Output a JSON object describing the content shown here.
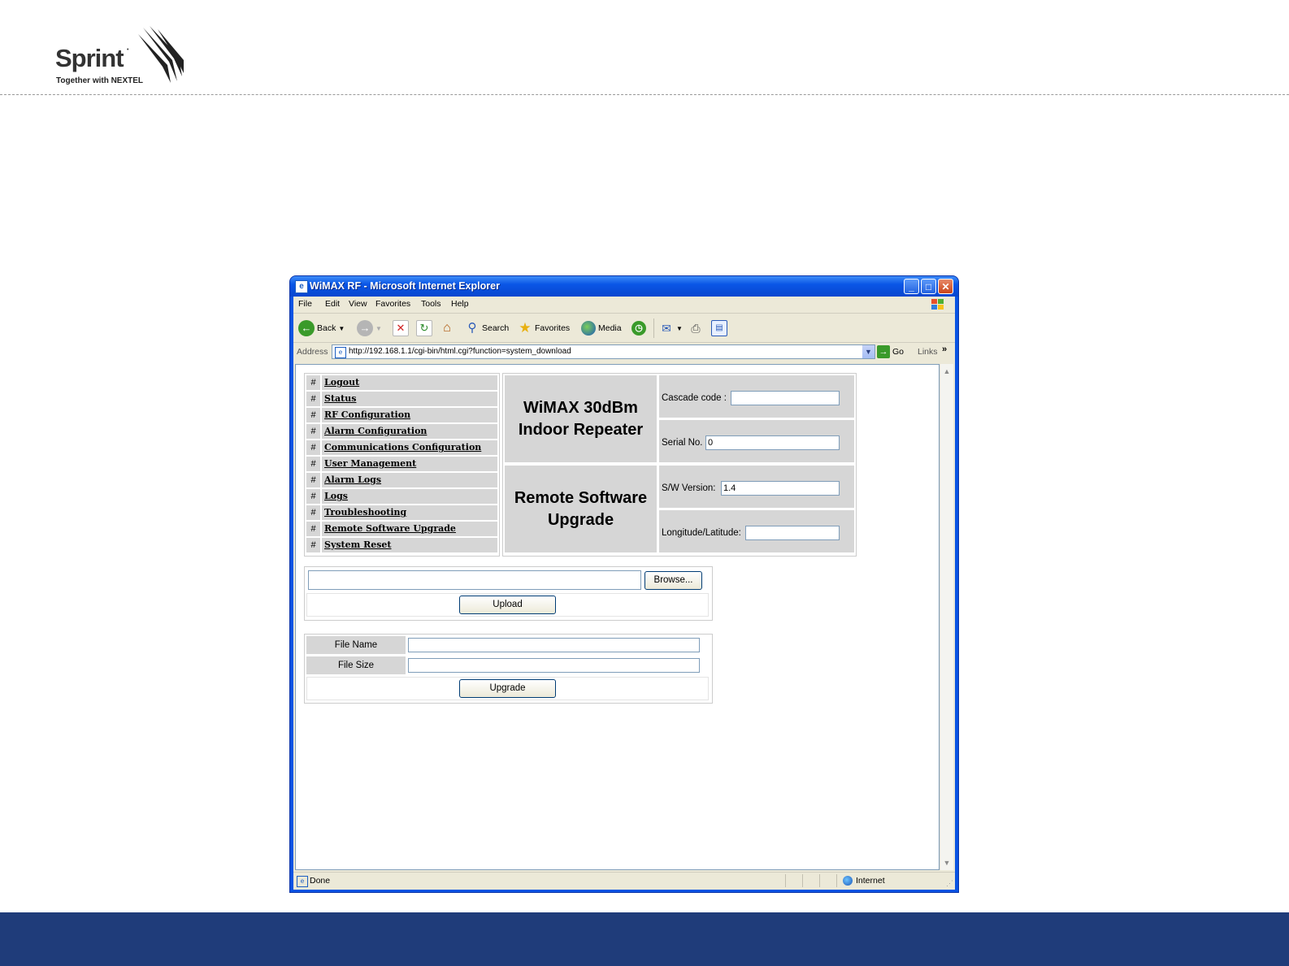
{
  "slide": {
    "logo_word": "Sprint",
    "logo_tagline": "Together with NEXTEL"
  },
  "window": {
    "title": "WiMAX RF - Microsoft Internet Explorer"
  },
  "menu": [
    "File",
    "Edit",
    "View",
    "Favorites",
    "Tools",
    "Help"
  ],
  "toolbar": {
    "back": "Back",
    "search": "Search",
    "favorites": "Favorites",
    "media": "Media"
  },
  "address": {
    "label": "Address",
    "url": "http://192.168.1.1/cgi-bin/html.cgi?function=system_download",
    "go": "Go",
    "links": "Links"
  },
  "nav": {
    "hash": "#",
    "items": [
      "Logout",
      "Status",
      "RF Configuration",
      "Alarm Configuration",
      "Communications Configuration",
      "User Management",
      "Alarm Logs",
      "Logs",
      "Troubleshooting",
      "Remote Software Upgrade",
      "System Reset"
    ]
  },
  "device": {
    "title_line1": "WiMAX 30dBm",
    "title_line2": "Indoor Repeater",
    "page_line1": "Remote Software",
    "page_line2": "Upgrade",
    "cascade_label": "Cascade code :",
    "cascade_value": "",
    "serial_label": "Serial No.",
    "serial_value": "0",
    "sw_label": "S/W Version:",
    "sw_value": "1.4",
    "lonlat_label": "Longitude/Latitude:",
    "lonlat_value": ""
  },
  "upload": {
    "file_value": "",
    "browse": "Browse...",
    "upload": "Upload"
  },
  "upgrade": {
    "file_name_label": "File Name",
    "file_size_label": "File Size",
    "file_name_value": "",
    "file_size_value": "",
    "upgrade": "Upgrade"
  },
  "status": {
    "text": "Done",
    "zone": "Internet"
  },
  "colors": {
    "footer": "#1f3c7a",
    "title_bar": "#0a56e6",
    "cell_gray": "#d6d6d6"
  }
}
